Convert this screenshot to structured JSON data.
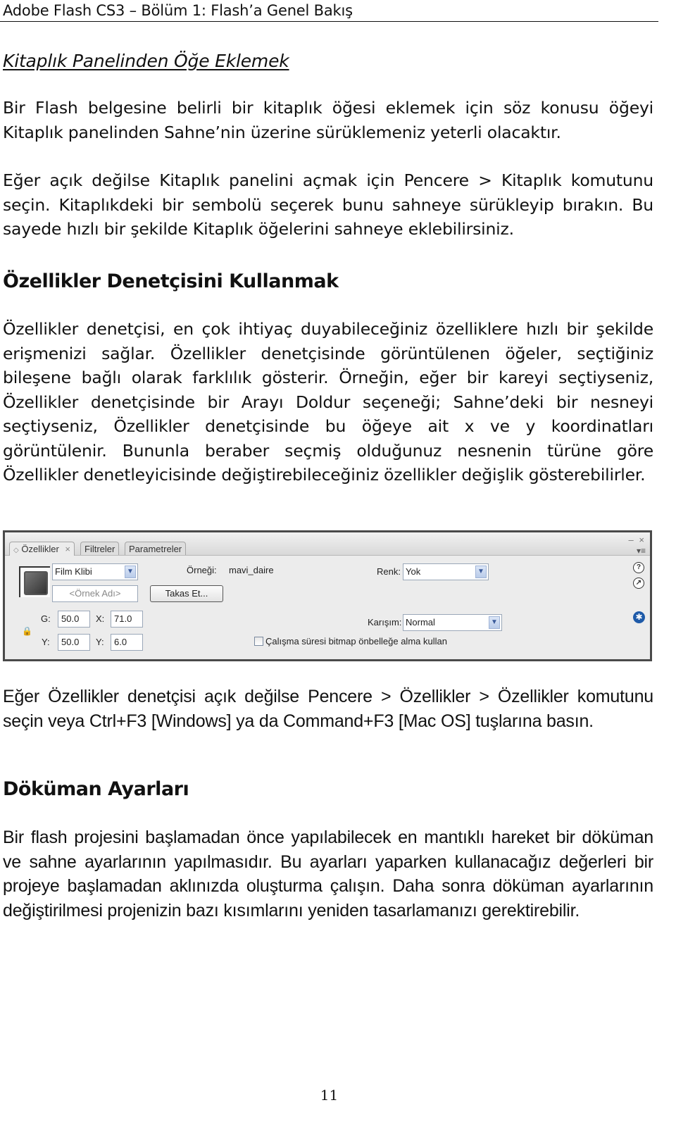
{
  "running_head": "Adobe Flash CS3 – Bölüm 1: Flash’a Genel Bakış",
  "section1": {
    "title": "Kitaplık Panelinden Öğe Eklemek",
    "paragraphs": [
      "Bir Flash belgesine belirli bir kitaplık öğesi eklemek için söz konusu öğeyi Kitaplık panelinden Sahne’nin üzerine sürüklemeniz yeterli olacaktır.",
      "Eğer açık değilse Kitaplık panelini açmak için Pencere > Kitaplık komutunu seçin. Kitaplıkdeki bir sembolü seçerek bunu sahneye sürükleyip bırakın. Bu sayede hızlı bir şekilde Kitaplık öğelerini sahneye eklebilirsiniz."
    ]
  },
  "section2": {
    "title": "Özellikler Denetçisini Kullanmak",
    "paragraphs": [
      "Özellikler denetçisi, en çok ihtiyaç duyabileceğiniz özelliklere hızlı bir şekilde erişmenizi sağlar. Özellikler denetçisinde görüntülenen öğeler, seçtiğiniz bileşene bağlı olarak farklılık gösterir. Örneğin, eğer bir kareyi seçtiyseniz, Özellikler denetçisinde bir Arayı Doldur seçeneği; Sahne’deki bir nesneyi seçtiyseniz, Özellikler denetçisinde bu öğeye ait x ve y koordinatları görüntülenir. Bununla beraber seçmiş olduğunuz nesnenin türüne göre Özellikler denetleyicisinde değiştirebileceğiniz özellikler değişlik gösterebilirler.",
      "Eğer Özellikler denetçisi açık değilse Pencere > Özellikler > Özellikler komutunu seçin veya Ctrl+F3  [Windows] ya da Command+F3 [Mac OS] tuşlarına basın."
    ]
  },
  "panel": {
    "tabs": [
      {
        "label": "Özellikler",
        "icon": "diamond-icon",
        "closable": true,
        "active": true
      },
      {
        "label": "Filtreler",
        "active": false
      },
      {
        "label": "Parametreler",
        "active": false
      }
    ],
    "window_controls": {
      "minimize": "–",
      "close": "×",
      "menu": "▾≡"
    },
    "symbol_type": {
      "value": "Film Klibi"
    },
    "instance_name": {
      "placeholder": "<Örnek Adı>"
    },
    "instance_of": {
      "label": "Örneği:",
      "value": "mavi_daire"
    },
    "swap_button": "Takas Et...",
    "width": {
      "label": "G:",
      "value": "50.0"
    },
    "height": {
      "label": "Y:",
      "value": "50.0"
    },
    "x": {
      "label": "X:",
      "value": "71.0"
    },
    "y": {
      "label": "Y:",
      "value": "6.0"
    },
    "color": {
      "label": "Renk:",
      "value": "Yok"
    },
    "blend": {
      "label": "Karışım:",
      "value": "Normal"
    },
    "cache_checkbox": {
      "label": "Çalışma süresi bitmap önbelleğe alma kullan",
      "checked": false
    },
    "side_icons": {
      "help": "?",
      "edit": "↗",
      "accessibility": "✱"
    },
    "accent_color": "#1e5aa8"
  },
  "section3": {
    "title": "Döküman Ayarları",
    "paragraphs": [
      "Bir flash projesini başlamadan önce yapılabilecek en mantıklı hareket bir döküman ve sahne ayarlarının yapılmasıdır. Bu ayarları yaparken kullanacağız değerleri bir projeye başlamadan aklınızda oluşturma çalışın. Daha sonra döküman ayarlarının değiştirilmesi projenizin bazı kısımlarını yeniden tasarlamanızı gerektirebilir."
    ]
  },
  "page_number": "11"
}
